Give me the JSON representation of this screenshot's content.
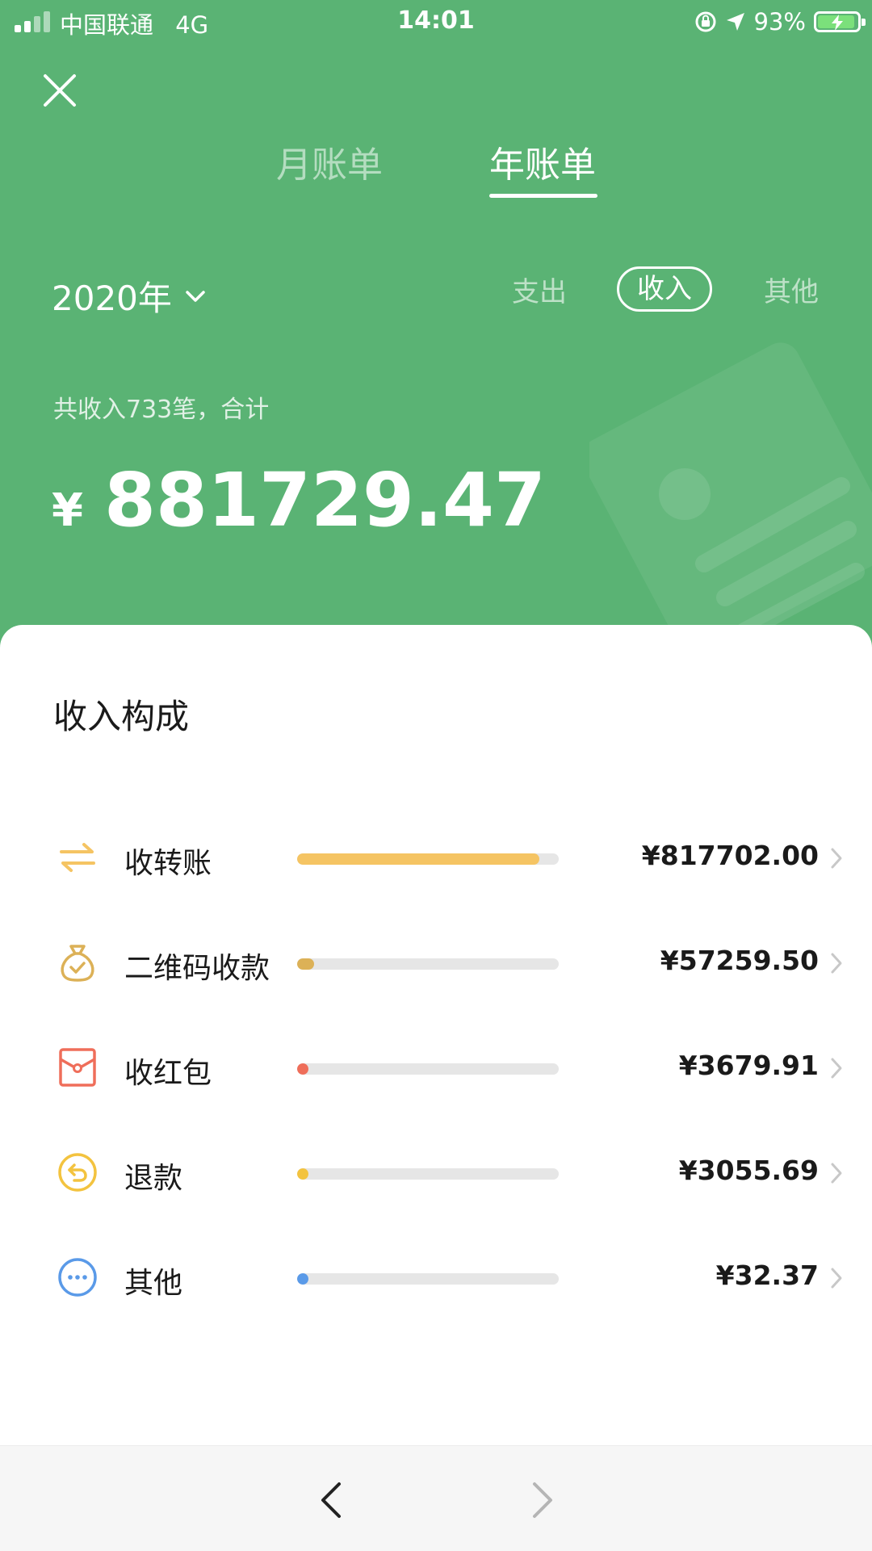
{
  "status_bar": {
    "carrier": "中国联通",
    "network": "4G",
    "time": "14:01",
    "battery_percent": "93%",
    "icons": [
      "signal-icon",
      "orientation-lock-icon",
      "location-icon",
      "battery-charging-icon"
    ]
  },
  "header": {
    "close_icon": "close-icon",
    "tabs": [
      {
        "label": "月账单",
        "active": false
      },
      {
        "label": "年账单",
        "active": true
      }
    ],
    "year_label": "2020年",
    "filters": [
      {
        "label": "支出",
        "active": false
      },
      {
        "label": "收入",
        "active": true
      },
      {
        "label": "其他",
        "active": false
      }
    ],
    "summary": "共收入733笔，合计",
    "currency": "¥",
    "total": "881729.47"
  },
  "breakdown": {
    "title": "收入构成",
    "items": [
      {
        "label": "收转账",
        "value": "¥817702.00",
        "icon": "transfer-icon",
        "color": "#f5c463",
        "share": 0.927
      },
      {
        "label": "二维码收款",
        "value": "¥57259.50",
        "icon": "money-bag-icon",
        "color": "#dcb157",
        "share": 0.065
      },
      {
        "label": "收红包",
        "value": "¥3679.91",
        "icon": "red-envelope-icon",
        "color": "#ef6e5a",
        "share": 0.004
      },
      {
        "label": "退款",
        "value": "¥3055.69",
        "icon": "refund-icon",
        "color": "#f3c33f",
        "share": 0.003
      },
      {
        "label": "其他",
        "value": "¥32.37",
        "icon": "more-icon",
        "color": "#5a9ae8",
        "share": 0.0
      }
    ]
  },
  "colors": {
    "header_bg": "#5ab374",
    "accent_white": "#ffffff",
    "text_dark": "#1a1a1a",
    "track_gray": "#e6e6e6"
  },
  "bottom_nav": {
    "back_icon": "chevron-left-icon",
    "forward_icon": "chevron-right-icon"
  }
}
